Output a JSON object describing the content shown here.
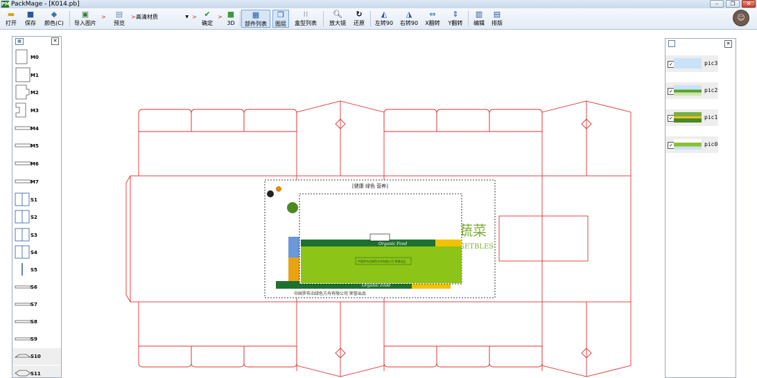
{
  "window": {
    "app_icon": "PM",
    "title": "PackMage - [K014.pb]",
    "controls": {
      "minimize": "–",
      "restore": "❐",
      "close": "✕"
    }
  },
  "toolbar": {
    "open": "打开",
    "save": "保存",
    "color": "颜色(C)",
    "import_image": "导入图片",
    "preview": "预览",
    "material": "高清材质",
    "confirm": "确定",
    "view3d": "3D",
    "part_list": "部件列表",
    "layers": "图层",
    "box_list": "盒型列表",
    "zoom_in": "放大镜",
    "restore": "还原",
    "rotate_left": "左转90",
    "rotate_right": "右转90",
    "flip_x": "X翻转",
    "flip_y": "Y翻转",
    "edit": "编辑",
    "layout": "排版",
    "arrow": ">",
    "combo_arrow": "▼"
  },
  "icons": {
    "open": "folder-icon",
    "save": "disk-icon",
    "color": "paint-bucket-icon",
    "import": "image-icon",
    "preview": "document-icon",
    "confirm": "check-icon",
    "view3d": "cube-icon",
    "zoom": "magnifier-icon",
    "restore": "undo-icon"
  },
  "part_panel": {
    "close": "✕",
    "parts": [
      "M0",
      "M1",
      "M2",
      "M3",
      "M4",
      "M5",
      "M6",
      "M7",
      "S1",
      "S2",
      "S3",
      "S4",
      "S5",
      "S6",
      "S7",
      "S8",
      "S9",
      "S10",
      "S11"
    ]
  },
  "layer_panel": {
    "close": "✕",
    "layers": [
      {
        "name": "pic3",
        "checked": "✓"
      },
      {
        "name": "pic2",
        "checked": "✓"
      },
      {
        "name": "pic1",
        "checked": "✓"
      },
      {
        "name": "pic0",
        "checked": "✓"
      }
    ]
  },
  "artwork": {
    "slogan": "[健康 绿色 营养]",
    "title_partial": "蔬菜",
    "subtitle_partial": "GETBLES",
    "banner_script": "Organic Food",
    "company": "中国罗布泊绿色方舟有限公司  荣誉出品",
    "small_label": "中国罗布泊绿色方舟有限公司  荣誉出品"
  },
  "colors": {
    "dieline": "#e03030",
    "accent_green": "#8cc418",
    "dark_green": "#1e7030",
    "yellow": "#f2c200",
    "blue": "#1f50c0"
  }
}
